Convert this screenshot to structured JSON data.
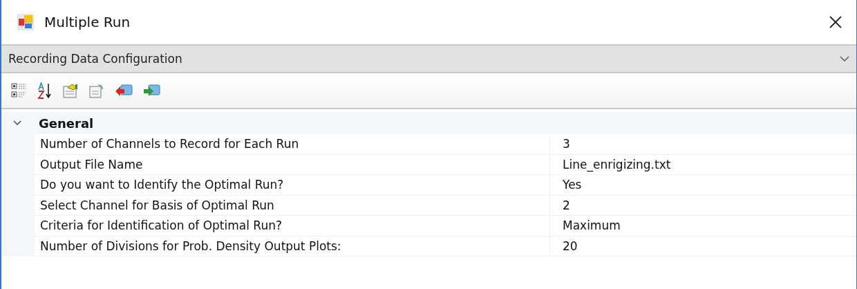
{
  "window": {
    "title": "Multiple Run"
  },
  "object_selector": {
    "value": "Recording Data Configuration"
  },
  "toolbar": {
    "buttons": [
      {
        "kind": "categorized"
      },
      {
        "kind": "alphabetical"
      },
      {
        "kind": "properties"
      },
      {
        "kind": "pages"
      },
      {
        "kind": "back"
      },
      {
        "kind": "forward"
      }
    ]
  },
  "category": {
    "label": "General",
    "expanded": true,
    "properties": [
      {
        "name": "Number of Channels to Record for Each Run",
        "value": "3"
      },
      {
        "name": "Output File Name",
        "value": "Line_enrigizing.txt"
      },
      {
        "name": "Do you want to Identify the Optimal Run?",
        "value": "Yes"
      },
      {
        "name": "Select Channel for Basis of Optimal Run",
        "value": "2"
      },
      {
        "name": "Criteria for Identification of Optimal Run?",
        "value": "Maximum"
      },
      {
        "name": "Number of Divisions for Prob. Density Output Plots:",
        "value": "20"
      }
    ]
  }
}
